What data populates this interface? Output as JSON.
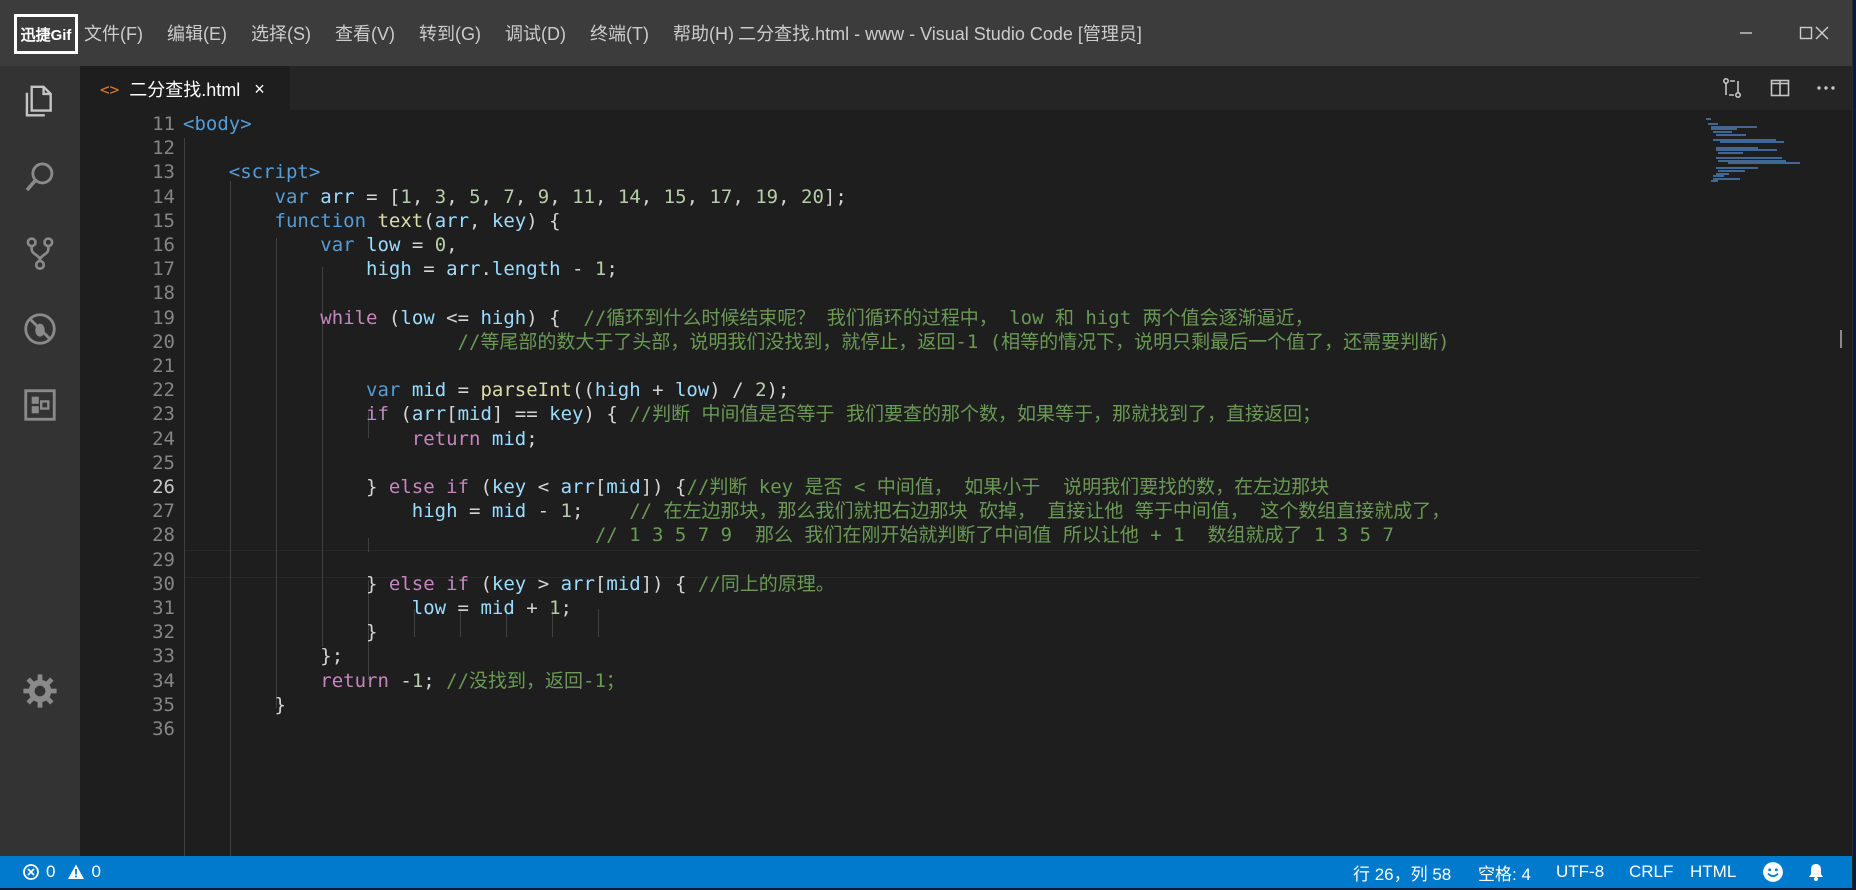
{
  "overlay_badge": "迅捷Gif",
  "menu": [
    "文件(F)",
    "编辑(E)",
    "选择(S)",
    "查看(V)",
    "转到(G)",
    "调试(D)",
    "终端(T)",
    "帮助(H)"
  ],
  "window_title": "二分查找.html - www - Visual Studio Code [管理员]",
  "tab": {
    "icon": "<>",
    "label": "二分查找.html",
    "close": "×"
  },
  "activity_icons": [
    "files-icon",
    "search-icon",
    "source-control-icon",
    "debug-icon",
    "extensions-icon",
    "gear-icon"
  ],
  "editor": {
    "current_line": 26,
    "lines": [
      {
        "n": "11",
        "tokens": [
          [
            "<body>",
            "tag"
          ]
        ]
      },
      {
        "n": "12",
        "tokens": []
      },
      {
        "n": "13",
        "tokens": [
          [
            "    ",
            "pun"
          ],
          [
            "<script>",
            "tag"
          ]
        ]
      },
      {
        "n": "14",
        "tokens": [
          [
            "        ",
            "pun"
          ],
          [
            "var",
            "kw"
          ],
          [
            " ",
            "pun"
          ],
          [
            "arr",
            "var"
          ],
          [
            " = [",
            "pun"
          ],
          [
            "1",
            "num"
          ],
          [
            ", ",
            "pun"
          ],
          [
            "3",
            "num"
          ],
          [
            ", ",
            "pun"
          ],
          [
            "5",
            "num"
          ],
          [
            ", ",
            "pun"
          ],
          [
            "7",
            "num"
          ],
          [
            ", ",
            "pun"
          ],
          [
            "9",
            "num"
          ],
          [
            ", ",
            "pun"
          ],
          [
            "11",
            "num"
          ],
          [
            ", ",
            "pun"
          ],
          [
            "14",
            "num"
          ],
          [
            ", ",
            "pun"
          ],
          [
            "15",
            "num"
          ],
          [
            ", ",
            "pun"
          ],
          [
            "17",
            "num"
          ],
          [
            ", ",
            "pun"
          ],
          [
            "19",
            "num"
          ],
          [
            ", ",
            "pun"
          ],
          [
            "20",
            "num"
          ],
          [
            "];",
            "pun"
          ]
        ]
      },
      {
        "n": "15",
        "tokens": [
          [
            "        ",
            "pun"
          ],
          [
            "function",
            "kw"
          ],
          [
            " ",
            "pun"
          ],
          [
            "text",
            "fn"
          ],
          [
            "(",
            "pun"
          ],
          [
            "arr",
            "var"
          ],
          [
            ", ",
            "pun"
          ],
          [
            "key",
            "var"
          ],
          [
            ") {",
            "pun"
          ]
        ]
      },
      {
        "n": "16",
        "tokens": [
          [
            "            ",
            "pun"
          ],
          [
            "var",
            "kw"
          ],
          [
            " ",
            "pun"
          ],
          [
            "low",
            "var"
          ],
          [
            " = ",
            "pun"
          ],
          [
            "0",
            "num"
          ],
          [
            ",",
            "pun"
          ]
        ]
      },
      {
        "n": "17",
        "tokens": [
          [
            "                ",
            "pun"
          ],
          [
            "high",
            "var"
          ],
          [
            " = ",
            "pun"
          ],
          [
            "arr",
            "var"
          ],
          [
            ".",
            "pun"
          ],
          [
            "length",
            "var"
          ],
          [
            " - ",
            "pun"
          ],
          [
            "1",
            "num"
          ],
          [
            ";",
            "pun"
          ]
        ]
      },
      {
        "n": "18",
        "tokens": []
      },
      {
        "n": "19",
        "tokens": [
          [
            "            ",
            "pun"
          ],
          [
            "while",
            "ctl"
          ],
          [
            " (",
            "pun"
          ],
          [
            "low",
            "var"
          ],
          [
            " <= ",
            "pun"
          ],
          [
            "high",
            "var"
          ],
          [
            ") {  ",
            "pun"
          ],
          [
            "//循环到什么时候结束呢？ 我们循环的过程中， low 和 higt 两个值会逐渐逼近，",
            "cmt"
          ]
        ]
      },
      {
        "n": "20",
        "tokens": [
          [
            "                        ",
            "pun"
          ],
          [
            "//等尾部的数大于了头部，说明我们没找到，就停止，返回-1 (相等的情况下，说明只剩最后一个值了，还需要判断)",
            "cmt"
          ]
        ]
      },
      {
        "n": "21",
        "tokens": []
      },
      {
        "n": "22",
        "tokens": [
          [
            "                ",
            "pun"
          ],
          [
            "var",
            "kw"
          ],
          [
            " ",
            "pun"
          ],
          [
            "mid",
            "var"
          ],
          [
            " = ",
            "pun"
          ],
          [
            "parseInt",
            "fn"
          ],
          [
            "((",
            "pun"
          ],
          [
            "high",
            "var"
          ],
          [
            " + ",
            "pun"
          ],
          [
            "low",
            "var"
          ],
          [
            ") / ",
            "pun"
          ],
          [
            "2",
            "num"
          ],
          [
            ");",
            "pun"
          ]
        ]
      },
      {
        "n": "23",
        "tokens": [
          [
            "                ",
            "pun"
          ],
          [
            "if",
            "ctl"
          ],
          [
            " (",
            "pun"
          ],
          [
            "arr",
            "var"
          ],
          [
            "[",
            "pun"
          ],
          [
            "mid",
            "var"
          ],
          [
            "] == ",
            "pun"
          ],
          [
            "key",
            "var"
          ],
          [
            ") { ",
            "pun"
          ],
          [
            "//判断 中间值是否等于 我们要查的那个数，如果等于，那就找到了，直接返回；",
            "cmt"
          ]
        ]
      },
      {
        "n": "24",
        "tokens": [
          [
            "                    ",
            "pun"
          ],
          [
            "return",
            "ctl"
          ],
          [
            " ",
            "pun"
          ],
          [
            "mid",
            "var"
          ],
          [
            ";",
            "pun"
          ]
        ]
      },
      {
        "n": "25",
        "tokens": []
      },
      {
        "n": "26",
        "tokens": [
          [
            "                ",
            "pun"
          ],
          [
            "} ",
            "pun"
          ],
          [
            "else",
            "ctl"
          ],
          [
            " ",
            "pun"
          ],
          [
            "if",
            "ctl"
          ],
          [
            " (",
            "pun"
          ],
          [
            "key",
            "var"
          ],
          [
            " < ",
            "pun"
          ],
          [
            "arr",
            "var"
          ],
          [
            "[",
            "pun"
          ],
          [
            "mid",
            "var"
          ],
          [
            "]) {",
            "pun"
          ],
          [
            "//判断 key 是否 < 中间值， 如果小于  说明我们要找的数，在左边那块",
            "cmt"
          ]
        ]
      },
      {
        "n": "27",
        "tokens": [
          [
            "                    ",
            "pun"
          ],
          [
            "high",
            "var"
          ],
          [
            " = ",
            "pun"
          ],
          [
            "mid",
            "var"
          ],
          [
            " - ",
            "pun"
          ],
          [
            "1",
            "num"
          ],
          [
            ";    ",
            "pun"
          ],
          [
            "// 在左边那块，那么我们就把右边那块 砍掉， 直接让他 等于中间值， 这个数组直接就成了，",
            "cmt"
          ]
        ]
      },
      {
        "n": "28",
        "tokens": [
          [
            "                                    ",
            "pun"
          ],
          [
            "// 1 3 5 7 9  那么 我们在刚开始就判断了中间值 所以让他 + 1  数组就成了 1 3 5 7",
            "cmt"
          ]
        ]
      },
      {
        "n": "29",
        "tokens": []
      },
      {
        "n": "30",
        "tokens": [
          [
            "                ",
            "pun"
          ],
          [
            "} ",
            "pun"
          ],
          [
            "else",
            "ctl"
          ],
          [
            " ",
            "pun"
          ],
          [
            "if",
            "ctl"
          ],
          [
            " (",
            "pun"
          ],
          [
            "key",
            "var"
          ],
          [
            " > ",
            "pun"
          ],
          [
            "arr",
            "var"
          ],
          [
            "[",
            "pun"
          ],
          [
            "mid",
            "var"
          ],
          [
            "]) { ",
            "pun"
          ],
          [
            "//同上的原理。",
            "cmt"
          ]
        ]
      },
      {
        "n": "31",
        "tokens": [
          [
            "                    ",
            "pun"
          ],
          [
            "low",
            "var"
          ],
          [
            " = ",
            "pun"
          ],
          [
            "mid",
            "var"
          ],
          [
            " + ",
            "pun"
          ],
          [
            "1",
            "num"
          ],
          [
            ";",
            "pun"
          ]
        ]
      },
      {
        "n": "32",
        "tokens": [
          [
            "                ",
            "pun"
          ],
          [
            "}",
            "pun"
          ]
        ]
      },
      {
        "n": "33",
        "tokens": [
          [
            "            ",
            "pun"
          ],
          [
            "};",
            "pun"
          ]
        ]
      },
      {
        "n": "34",
        "tokens": [
          [
            "            ",
            "pun"
          ],
          [
            "return",
            "ctl"
          ],
          [
            " -",
            "pun"
          ],
          [
            "1",
            "num"
          ],
          [
            "; ",
            "pun"
          ],
          [
            "//没找到，返回-1；",
            "cmt"
          ]
        ]
      },
      {
        "n": "35",
        "tokens": [
          [
            "        ",
            "pun"
          ],
          [
            "}",
            "pun"
          ]
        ]
      },
      {
        "n": "36",
        "tokens": []
      }
    ]
  },
  "status": {
    "errors": "0",
    "warnings": "0",
    "position": "行 26，列 58",
    "spaces": "空格: 4",
    "encoding": "UTF-8",
    "eol": "CRLF",
    "language": "HTML"
  },
  "colors": {
    "title_bar": "#3c3c3c",
    "activity_bar": "#333333",
    "editor_bg": "#1e1e1e",
    "status_bar": "#007acc",
    "keyword": "#569cd6",
    "control": "#c586c0",
    "variable": "#9cdcfe",
    "function": "#dcdcaa",
    "number": "#b5cea8",
    "comment": "#6a9955"
  }
}
